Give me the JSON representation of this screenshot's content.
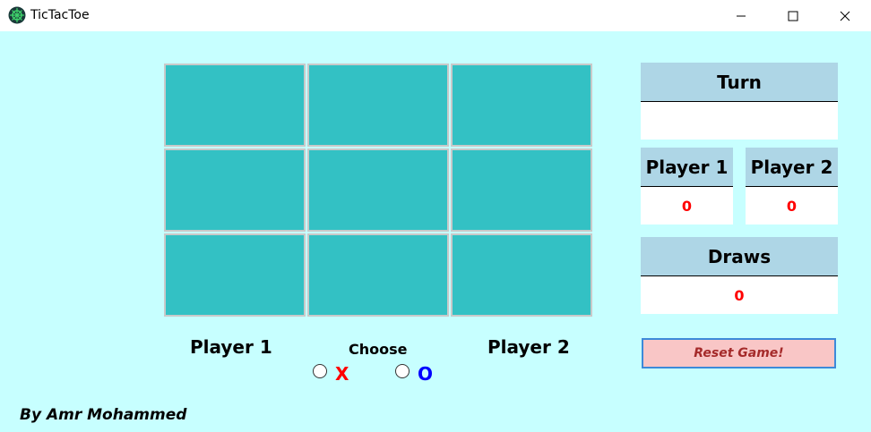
{
  "window": {
    "title": "TicTacToe"
  },
  "board": {
    "cells": [
      "",
      "",
      "",
      "",
      "",
      "",
      "",
      "",
      ""
    ]
  },
  "labels": {
    "player1": "Player 1",
    "player2": "Player 2",
    "choose": "Choose",
    "x_option": "X",
    "o_option": "O",
    "author": "By Amr Mohammed"
  },
  "scoreboard": {
    "turn_label": "Turn",
    "turn_value": "",
    "player1_label": "Player 1",
    "player1_score": "0",
    "player2_label": "Player 2",
    "player2_score": "0",
    "draws_label": "Draws",
    "draws_value": "0"
  },
  "reset_label": "Reset Game!",
  "colors": {
    "background": "#c7ffff",
    "cell": "#33c1c4",
    "panel_header": "#aed6e6",
    "x_color": "#ff0000",
    "o_color": "#0000ff",
    "reset_bg": "#f9c6c6"
  }
}
